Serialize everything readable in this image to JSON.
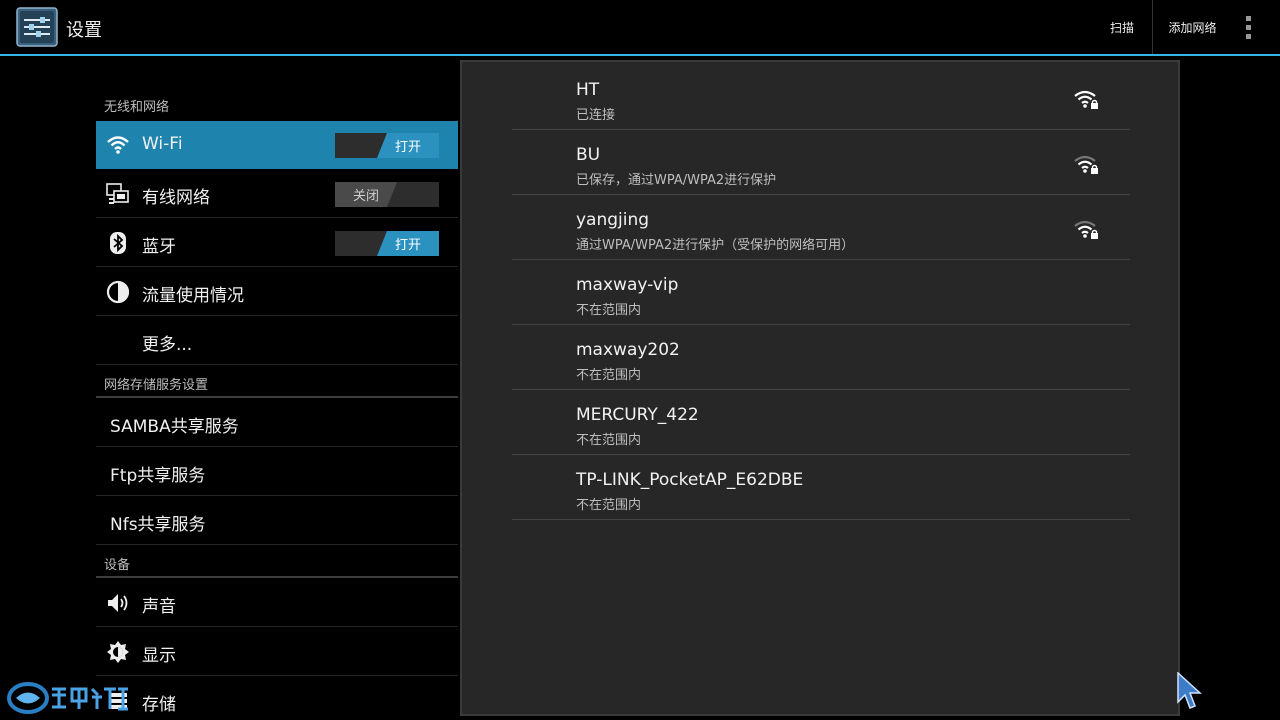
{
  "actionbar": {
    "title": "设置",
    "scan_label": "扫描",
    "add_network_label": "添加网络",
    "accent_color": "#33b5e5"
  },
  "sidebar": {
    "sections": [
      {
        "header": "无线和网络"
      },
      {
        "header": "网络存储服务设置"
      },
      {
        "header": "设备"
      }
    ],
    "items": [
      {
        "label": "Wi-Fi",
        "icon": "wifi-icon",
        "toggle": "打开",
        "toggle_state": "on",
        "selected": true
      },
      {
        "label": "有线网络",
        "icon": "ethernet-icon",
        "toggle": "关闭",
        "toggle_state": "off"
      },
      {
        "label": "蓝牙",
        "icon": "bluetooth-icon",
        "toggle": "打开",
        "toggle_state": "on"
      },
      {
        "label": "流量使用情况",
        "icon": "data-usage-icon"
      },
      {
        "label": "更多..."
      },
      {
        "label": "SAMBA共享服务"
      },
      {
        "label": "Ftp共享服务"
      },
      {
        "label": "Nfs共享服务"
      },
      {
        "label": "声音",
        "icon": "speaker-icon"
      },
      {
        "label": "显示",
        "icon": "brightness-icon"
      },
      {
        "label": "存储",
        "icon": "storage-icon"
      }
    ]
  },
  "networks": [
    {
      "ssid": "HT",
      "status": "已连接",
      "signal_icon": "wifi-lock-icon",
      "signal": "strong"
    },
    {
      "ssid": "BU",
      "status": "已保存，通过WPA/WPA2进行保护",
      "signal_icon": "wifi-lock-icon",
      "signal": "medium"
    },
    {
      "ssid": "yangjing",
      "status": "通过WPA/WPA2进行保护（受保护的网络可用）",
      "signal_icon": "wifi-lock-icon",
      "signal": "medium"
    },
    {
      "ssid": "maxway-vip",
      "status": "不在范围内"
    },
    {
      "ssid": "maxway202",
      "status": "不在范围内"
    },
    {
      "ssid": "MERCURY_422",
      "status": "不在范围内"
    },
    {
      "ssid": "TP-LINK_PocketAP_E62DBE",
      "status": "不在范围内"
    }
  ],
  "watermark": {
    "text": "家电论坛"
  }
}
